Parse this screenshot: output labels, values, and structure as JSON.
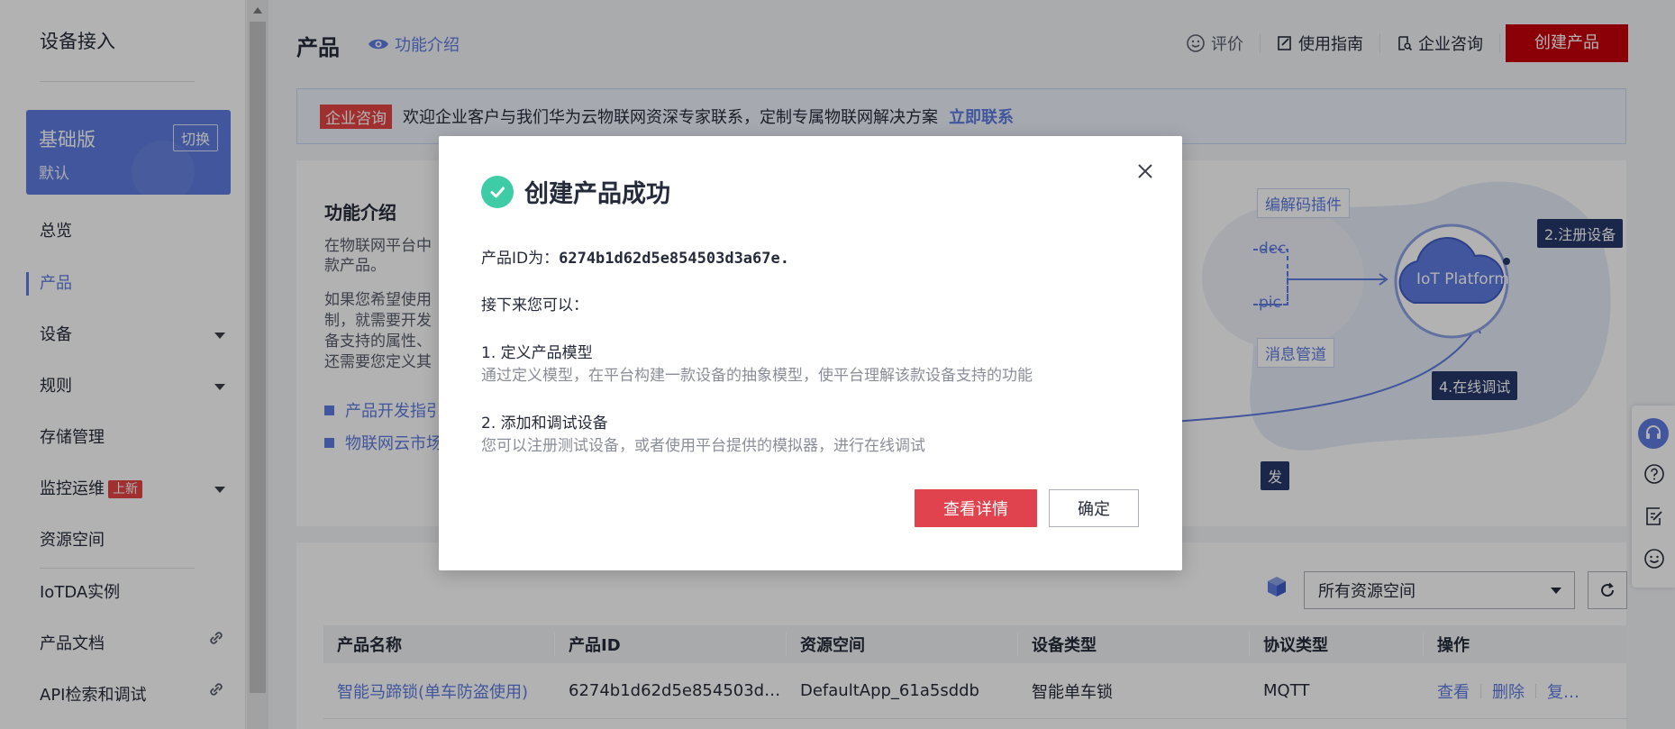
{
  "sidebar": {
    "title": "设备接入",
    "plan": {
      "name": "基础版",
      "switch_label": "切换",
      "env": "默认"
    },
    "items": [
      {
        "label": "总览"
      },
      {
        "label": "产品"
      },
      {
        "label": "设备"
      },
      {
        "label": "规则"
      },
      {
        "label": "存储管理"
      },
      {
        "label": "监控运维",
        "badge": "上新"
      },
      {
        "label": "资源空间"
      },
      {
        "label": "IoTDA实例"
      },
      {
        "label": "产品文档"
      },
      {
        "label": "API检索和调试"
      }
    ]
  },
  "header": {
    "title": "产品",
    "feature_link": "功能介绍",
    "actions": {
      "rate": "评价",
      "guide": "使用指南",
      "consult": "企业咨询"
    },
    "create_button": "创建产品"
  },
  "notice": {
    "tag": "企业咨询",
    "text": "欢迎企业客户与我们华为云物联网资深专家联系，定制专属物联网解决方案",
    "cta": "立即联系"
  },
  "intro": {
    "title": "功能介绍",
    "para1_line1": "在物联网平台中",
    "para1_line2": "款产品。",
    "para2_line1": "如果您希望使用",
    "para2_line2": "制，就需要开发",
    "para2_line3": "备支持的属性、",
    "para2_line4": "还需要您定义其",
    "link1": "产品开发指引",
    "link2": "物联网云市场",
    "diagram": {
      "codec_plugin": "编解码插件",
      "codec": "dec",
      "topic": "pic",
      "msg_pipe": "消息管道",
      "platform": "IoT Platform",
      "register": "2.注册设备",
      "debug": "4.在线调试",
      "dev": "发"
    }
  },
  "list": {
    "resource_select": "所有资源空间",
    "columns": [
      "产品名称",
      "产品ID",
      "资源空间",
      "设备类型",
      "协议类型",
      "操作"
    ],
    "rows": [
      {
        "name": "智能马蹄锁(单车防盗使用)",
        "id": "6274b1d62d5e854503d3…",
        "space": "DefaultApp_61a5sddb",
        "device_type": "智能单车锁",
        "protocol": "MQTT",
        "op_view": "查看",
        "op_delete": "删除",
        "op_copy": "复…"
      }
    ]
  },
  "modal": {
    "title": "创建产品成功",
    "id_label": "产品ID为：",
    "id_value": "6274b1d62d5e854503d3a67e.",
    "next_label": "接下来您可以：",
    "step1_title": "1. 定义产品模型",
    "step1_desc": "通过定义模型，在平台构建一款设备的抽象模型，使平台理解该款设备支持的功能",
    "step2_title": "2. 添加和调试设备",
    "step2_desc": "您可以注册测试设备，或者使用平台提供的模拟器，进行在线调试",
    "detail_button": "查看详情",
    "ok_button": "确定"
  },
  "colors": {
    "brand_red": "#c7000b",
    "accent_blue": "#5e7ce0",
    "success_green": "#3dcca6",
    "detail_red": "#e0434d"
  }
}
